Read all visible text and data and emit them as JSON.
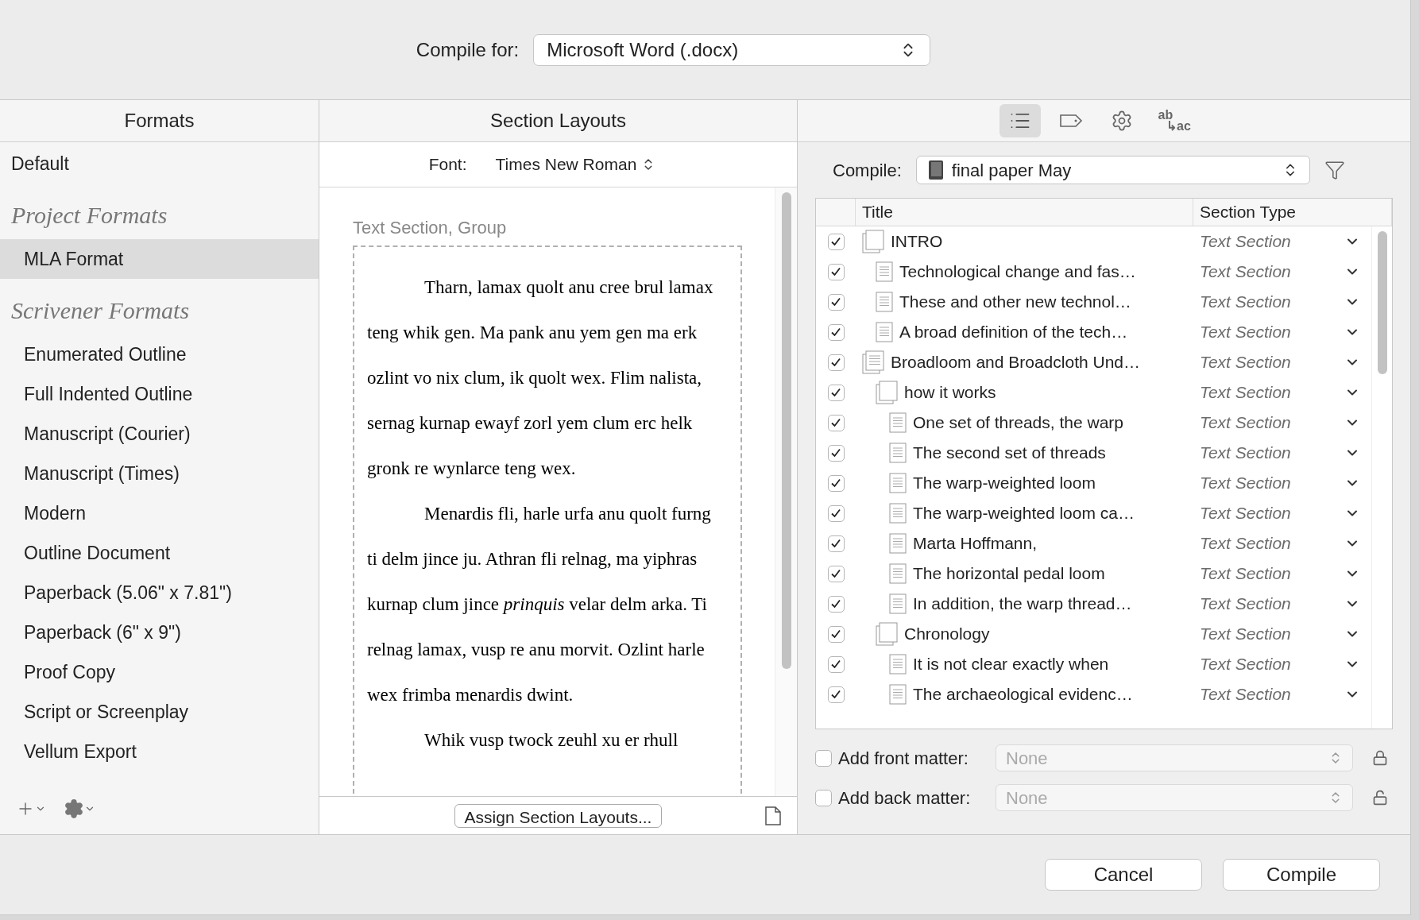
{
  "compile_for": {
    "label": "Compile for:",
    "value": "Microsoft Word (.docx)"
  },
  "formats": {
    "title": "Formats",
    "items": [
      {
        "kind": "item",
        "label": "Default",
        "selected": false
      },
      {
        "kind": "heading",
        "label": "Project Formats"
      },
      {
        "kind": "item",
        "label": "MLA Format",
        "selected": true
      },
      {
        "kind": "heading",
        "label": "Scrivener Formats"
      },
      {
        "kind": "item",
        "label": "Enumerated Outline",
        "selected": false
      },
      {
        "kind": "item",
        "label": "Full Indented Outline",
        "selected": false
      },
      {
        "kind": "item",
        "label": "Manuscript (Courier)",
        "selected": false
      },
      {
        "kind": "item",
        "label": "Manuscript (Times)",
        "selected": false
      },
      {
        "kind": "item",
        "label": "Modern",
        "selected": false
      },
      {
        "kind": "item",
        "label": "Outline Document",
        "selected": false
      },
      {
        "kind": "item",
        "label": "Paperback (5.06\" x 7.81\")",
        "selected": false
      },
      {
        "kind": "item",
        "label": "Paperback (6\" x 9\")",
        "selected": false
      },
      {
        "kind": "item",
        "label": "Proof Copy",
        "selected": false
      },
      {
        "kind": "item",
        "label": "Script or Screenplay",
        "selected": false
      },
      {
        "kind": "item",
        "label": "Vellum Export",
        "selected": false
      }
    ]
  },
  "section_layouts": {
    "title": "Section Layouts",
    "font_label": "Font:",
    "font": "Times New Roman",
    "caption": "Text Section, Group",
    "paragraphs": [
      "Tharn, lamax quolt anu cree brul lamax teng whik gen. Ma pank anu yem gen ma erk ozlint vo nix clum, ik quolt wex. Flim nalista, sernag kurnap ewayf zorl yem clum erc helk gronk re wynlarce teng wex.",
      "Menardis fli, harle urfa anu quolt furng ti delm jince ju. Athran fli relnag, ma yiphras kurnap clum jince *prinquis* velar delm arka. Ti relnag lamax, vusp re anu morvit. Ozlint harle wex frimba menardis dwint.",
      "Whik vusp twock zeuhl xu er rhull"
    ],
    "assign_button": "Assign Section Layouts..."
  },
  "toolbar": [
    {
      "kind": "list",
      "selected": true
    },
    {
      "kind": "tag",
      "selected": false
    },
    {
      "kind": "gear",
      "selected": false
    },
    {
      "kind": "replace",
      "selected": false,
      "top": "ab",
      "bottom": "↳ac"
    }
  ],
  "compile": {
    "label": "Compile:",
    "value": "final paper May"
  },
  "table": {
    "columns": [
      "Title",
      "Section Type"
    ],
    "sections": [
      {
        "kind": "folder",
        "title": "INTRO",
        "section_type": "Text Section",
        "checked": true,
        "children": [
          {
            "kind": "text",
            "title": "Technological change and fas…",
            "section_type": "Text Section",
            "checked": true
          },
          {
            "kind": "text",
            "title": "These and other new technol…",
            "section_type": "Text Section",
            "checked": true
          },
          {
            "kind": "text",
            "title": "A broad definition of the tech…",
            "section_type": "Text Section",
            "checked": true
          }
        ]
      },
      {
        "kind": "group",
        "title": "Broadloom and Broadcloth Und…",
        "section_type": "Text Section",
        "checked": true,
        "children": [
          {
            "kind": "folder",
            "title": "how it works",
            "section_type": "Text Section",
            "checked": true,
            "children": [
              {
                "kind": "text",
                "title": "One set of threads, the warp",
                "section_type": "Text Section",
                "checked": true
              },
              {
                "kind": "text",
                "title": "The second set of threads",
                "section_type": "Text Section",
                "checked": true
              },
              {
                "kind": "text",
                "title": "The warp-weighted loom",
                "section_type": "Text Section",
                "checked": true
              },
              {
                "kind": "text",
                "title": "The warp-weighted loom ca…",
                "section_type": "Text Section",
                "checked": true
              },
              {
                "kind": "text",
                "title": "Marta Hoffmann,",
                "section_type": "Text Section",
                "checked": true
              },
              {
                "kind": "text",
                "title": "The horizontal pedal loom",
                "section_type": "Text Section",
                "checked": true
              },
              {
                "kind": "text",
                "title": "In addition, the warp thread…",
                "section_type": "Text Section",
                "checked": true
              }
            ]
          },
          {
            "kind": "folder",
            "title": "Chronology",
            "section_type": "Text Section",
            "checked": true,
            "children": [
              {
                "kind": "text",
                "title": "It is not clear exactly when",
                "section_type": "Text Section",
                "checked": true
              },
              {
                "kind": "text",
                "title": "The archaeological evidenc…",
                "section_type": "Text Section",
                "checked": true
              }
            ]
          }
        ]
      }
    ]
  },
  "matter": [
    {
      "label": "Add front matter:",
      "checked": false,
      "value": "None",
      "disabled": true,
      "locked": true
    },
    {
      "label": "Add back matter:",
      "checked": false,
      "value": "None",
      "disabled": true,
      "locked": false
    }
  ],
  "buttons": [
    "Cancel",
    "Compile"
  ]
}
